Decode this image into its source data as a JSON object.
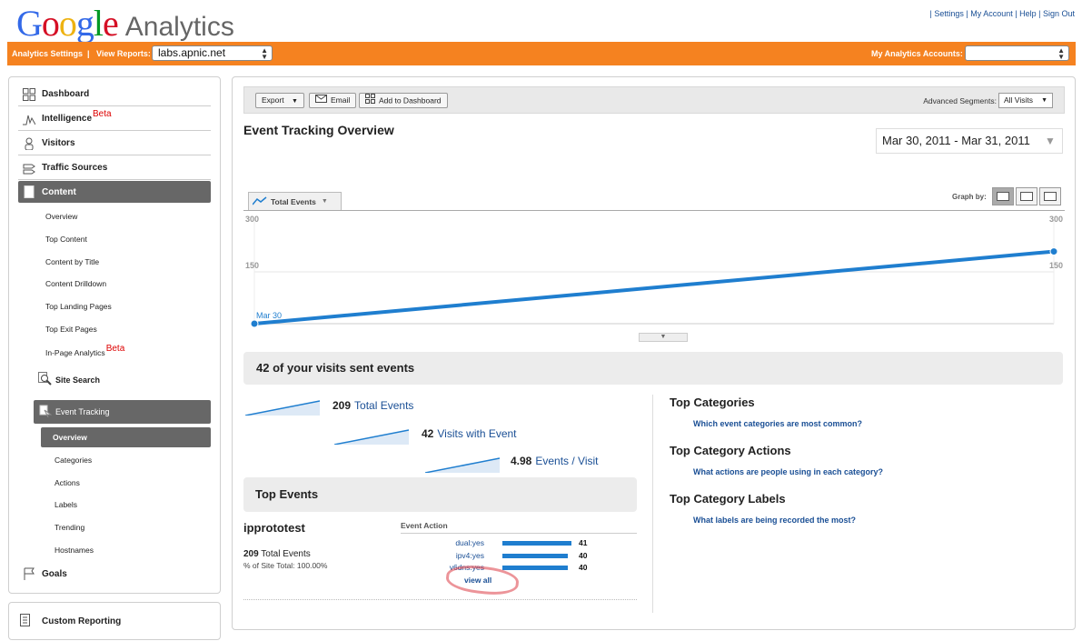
{
  "header": {
    "logo_google": "Google",
    "logo_product": "Analytics",
    "links": [
      "Settings",
      "My Account",
      "Help",
      "Sign Out"
    ]
  },
  "orange_bar": {
    "analytics_settings": "Analytics Settings",
    "view_reports_label": "View Reports:",
    "view_reports_value": "labs.apnic.net",
    "my_accounts_label": "My Analytics Accounts:",
    "my_accounts_value": ""
  },
  "sidebar": {
    "main_items": [
      {
        "label": "Dashboard"
      },
      {
        "label": "Intelligence",
        "badge": "Beta"
      },
      {
        "label": "Visitors"
      },
      {
        "label": "Traffic Sources"
      },
      {
        "label": "Content"
      }
    ],
    "content_subitems": [
      "Overview",
      "Top Content",
      "Content by Title",
      "Content Drilldown",
      "Top Landing Pages",
      "Top Exit Pages",
      "In-Page Analytics"
    ],
    "inpage_badge": "Beta",
    "site_search": "Site Search",
    "event_tracking": "Event Tracking",
    "event_subitems": [
      "Overview",
      "Categories",
      "Actions",
      "Labels",
      "Trending",
      "Hostnames"
    ],
    "goals": "Goals",
    "custom_reporting": "Custom Reporting"
  },
  "toolbar": {
    "export": "Export",
    "email": "Email",
    "add_to_dashboard": "Add to Dashboard",
    "segments_label": "Advanced Segments:",
    "segments_value": "All Visits"
  },
  "page": {
    "title": "Event Tracking Overview",
    "date_range": "Mar 30, 2011 - Mar 31, 2011"
  },
  "graph": {
    "metric_tab": "Total Events",
    "graph_by_label": "Graph by:"
  },
  "chart_data": {
    "type": "line",
    "x": [
      "Mar 30",
      "Mar 31"
    ],
    "series": [
      {
        "name": "Total Events",
        "values": [
          0,
          209
        ]
      }
    ],
    "ylim": [
      0,
      300
    ],
    "y_ticks": [
      "300",
      "150"
    ],
    "x_label_shown": "Mar 30",
    "color": "#1f7ecf"
  },
  "summary": {
    "headline": "42 of your visits sent events",
    "stats": [
      {
        "value": "209",
        "label": "Total Events"
      },
      {
        "value": "42",
        "label": "Visits with Event"
      },
      {
        "value": "4.98",
        "label": "Events / Visit"
      }
    ]
  },
  "top_categories": [
    {
      "title": "Top Categories",
      "link": "Which event categories are most common?"
    },
    {
      "title": "Top Category Actions",
      "link": "What actions are people using in each category?"
    },
    {
      "title": "Top Category Labels",
      "link": "What labels are being recorded the most?"
    }
  ],
  "top_events": {
    "header": "Top Events",
    "category": "ipprototest",
    "column_header": "Event Action",
    "total_value": "209",
    "total_label": "Total Events",
    "site_total": "% of Site Total: 100.00%",
    "actions": [
      {
        "name": "dual:yes",
        "value": "41",
        "fraction": 1.0
      },
      {
        "name": "ipv4:yes",
        "value": "40",
        "fraction": 0.95
      },
      {
        "name": "v6dns:yes",
        "value": "40",
        "fraction": 0.95
      }
    ],
    "view_all": "view all"
  }
}
